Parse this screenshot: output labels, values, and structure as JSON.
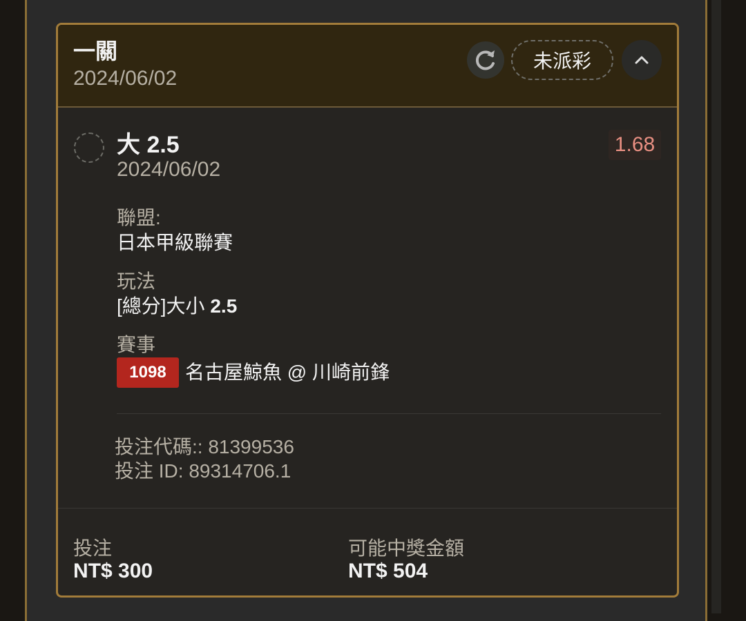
{
  "card": {
    "title": "一關",
    "date": "2024/06/02",
    "status": "未派彩",
    "icons": [
      "refresh-icon",
      "chevron-up-icon"
    ]
  },
  "bet": {
    "selection": "大 2.5",
    "date": "2024/06/02",
    "odds": "1.68",
    "league_label": "聯盟:",
    "league": "日本甲級聯賽",
    "market_label": "玩法",
    "market_prefix": "[總分]大小",
    "market_value": "2.5",
    "event_label": "賽事",
    "event_id": "1098",
    "event_name": "名古屋鯨魚 @ 川崎前鋒",
    "bet_code": "投注代碼:: 81399536",
    "bet_id": "投注 ID: 89314706.1"
  },
  "footer": {
    "stake_label": "投注",
    "stake_value": "NT$ 300",
    "payout_label": "可能中獎金額",
    "payout_value": "NT$ 504"
  },
  "colors": {
    "accent_border": "#a27c3a",
    "header_bg": "#302610",
    "odds_text": "#e88f82",
    "event_badge": "#b3261e"
  }
}
